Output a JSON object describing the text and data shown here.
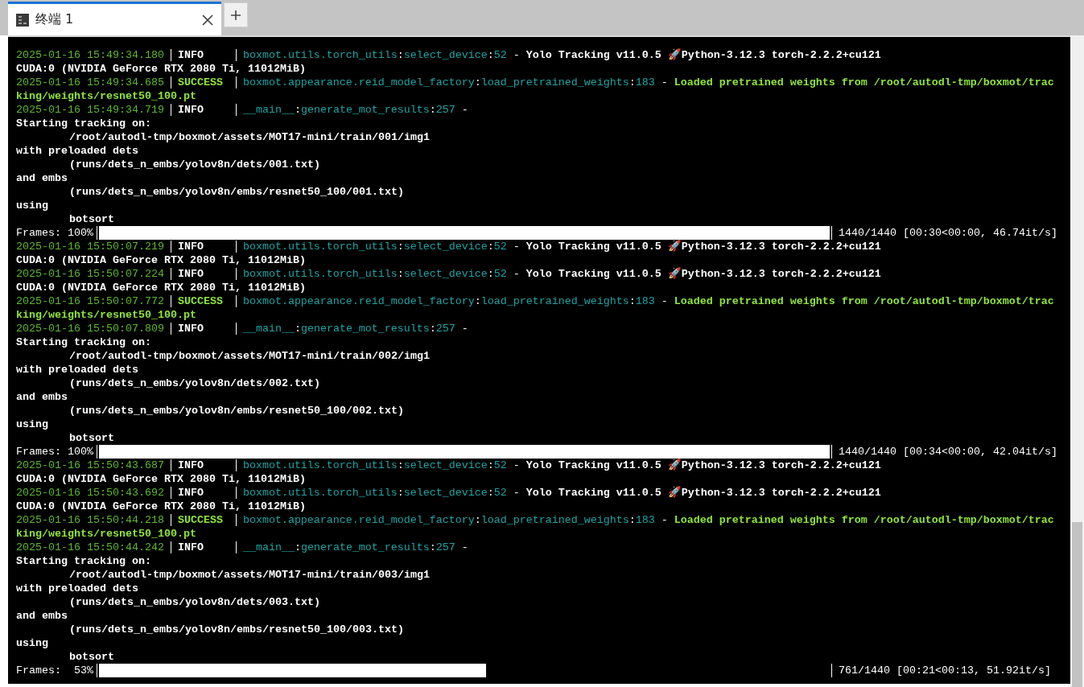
{
  "tabs": [
    {
      "title": "终端 1",
      "selected": true
    }
  ],
  "lines": [
    {
      "kind": "log",
      "time": "2025-01-16 15:49:34.180",
      "level": "INFO",
      "source": "boxmot.utils.torch_utils:select_device:52 - ",
      "message": "Yolo Tracking v11.0.5 🚀Python-3.12.3 torch-2.2.2+cu121",
      "continuation": "CUDA:0 (NVIDIA GeForce RTX 2080 Ti, 11012MiB)"
    },
    {
      "kind": "log",
      "time": "2025-01-16 15:49:34.685",
      "level": "SUCCESS",
      "source": "boxmot.appearance.reid_model_factory:load_pretrained_weights:183 - ",
      "message": "Loaded pretrained weights from /root/autodl-tmp/boxmot/trac",
      "continuation": "king/weights/resnet50_100.pt"
    },
    {
      "kind": "log",
      "time": "2025-01-16 15:49:34.719",
      "level": "INFO",
      "source": "__main__:generate_mot_results:257 - "
    },
    {
      "kind": "text",
      "text": "Starting tracking on:"
    },
    {
      "kind": "indented",
      "text": "/root/autodl-tmp/boxmot/assets/MOT17-mini/train/001/img1"
    },
    {
      "kind": "text",
      "text": "with preloaded dets"
    },
    {
      "kind": "indented",
      "text": "(runs/dets_n_embs/yolov8n/dets/001.txt)"
    },
    {
      "kind": "text",
      "text": "and embs"
    },
    {
      "kind": "indented",
      "text": "(runs/dets_n_embs/yolov8n/embs/resnet50_100/001.txt)"
    },
    {
      "kind": "text",
      "text": "using"
    },
    {
      "kind": "indented",
      "text": "botsort"
    },
    {
      "kind": "progress",
      "label": "Frames: 100%",
      "level": 1,
      "stats": "1440/1440 [00:30<00:00, 46.74it/s]"
    },
    {
      "kind": "log",
      "time": "2025-01-16 15:50:07.219",
      "level": "INFO",
      "source": "boxmot.utils.torch_utils:select_device:52 - ",
      "message": "Yolo Tracking v11.0.5 🚀Python-3.12.3 torch-2.2.2+cu121",
      "continuation": "CUDA:0 (NVIDIA GeForce RTX 2080 Ti, 11012MiB)"
    },
    {
      "kind": "log",
      "time": "2025-01-16 15:50:07.224",
      "level": "INFO",
      "source": "boxmot.utils.torch_utils:select_device:52 - ",
      "message": "Yolo Tracking v11.0.5 🚀Python-3.12.3 torch-2.2.2+cu121",
      "continuation": "CUDA:0 (NVIDIA GeForce RTX 2080 Ti, 11012MiB)"
    },
    {
      "kind": "log",
      "time": "2025-01-16 15:50:07.772",
      "level": "SUCCESS",
      "source": "boxmot.appearance.reid_model_factory:load_pretrained_weights:183 - ",
      "message": "Loaded pretrained weights from /root/autodl-tmp/boxmot/trac",
      "continuation": "king/weights/resnet50_100.pt"
    },
    {
      "kind": "log",
      "time": "2025-01-16 15:50:07.809",
      "level": "INFO",
      "source": "__main__:generate_mot_results:257 - "
    },
    {
      "kind": "text",
      "text": "Starting tracking on:"
    },
    {
      "kind": "indented",
      "text": "/root/autodl-tmp/boxmot/assets/MOT17-mini/train/002/img1"
    },
    {
      "kind": "text",
      "text": "with preloaded dets"
    },
    {
      "kind": "indented",
      "text": "(runs/dets_n_embs/yolov8n/dets/002.txt)"
    },
    {
      "kind": "text",
      "text": "and embs"
    },
    {
      "kind": "indented",
      "text": "(runs/dets_n_embs/yolov8n/embs/resnet50_100/002.txt)"
    },
    {
      "kind": "text",
      "text": "using"
    },
    {
      "kind": "indented",
      "text": "botsort"
    },
    {
      "kind": "progress",
      "label": "Frames: 100%",
      "level": 1,
      "stats": "1440/1440 [00:34<00:00, 42.04it/s]"
    },
    {
      "kind": "log",
      "time": "2025-01-16 15:50:43.687",
      "level": "INFO",
      "source": "boxmot.utils.torch_utils:select_device:52 - ",
      "message": "Yolo Tracking v11.0.5 🚀Python-3.12.3 torch-2.2.2+cu121",
      "continuation": "CUDA:0 (NVIDIA GeForce RTX 2080 Ti, 11012MiB)"
    },
    {
      "kind": "log",
      "time": "2025-01-16 15:50:43.692",
      "level": "INFO",
      "source": "boxmot.utils.torch_utils:select_device:52 - ",
      "message": "Yolo Tracking v11.0.5 🚀Python-3.12.3 torch-2.2.2+cu121",
      "continuation": "CUDA:0 (NVIDIA GeForce RTX 2080 Ti, 11012MiB)"
    },
    {
      "kind": "log",
      "time": "2025-01-16 15:50:44.218",
      "level": "SUCCESS",
      "source": "boxmot.appearance.reid_model_factory:load_pretrained_weights:183 - ",
      "message": "Loaded pretrained weights from /root/autodl-tmp/boxmot/trac",
      "continuation": "king/weights/resnet50_100.pt"
    },
    {
      "kind": "log",
      "time": "2025-01-16 15:50:44.242",
      "level": "INFO",
      "source": "__main__:generate_mot_results:257 - "
    },
    {
      "kind": "text",
      "text": "Starting tracking on:"
    },
    {
      "kind": "indented",
      "text": "/root/autodl-tmp/boxmot/assets/MOT17-mini/train/003/img1"
    },
    {
      "kind": "text",
      "text": "with preloaded dets"
    },
    {
      "kind": "indented",
      "text": "(runs/dets_n_embs/yolov8n/dets/003.txt)"
    },
    {
      "kind": "text",
      "text": "and embs"
    },
    {
      "kind": "indented",
      "text": "(runs/dets_n_embs/yolov8n/embs/resnet50_100/003.txt)"
    },
    {
      "kind": "text",
      "text": "using"
    },
    {
      "kind": "indented",
      "text": "botsort"
    },
    {
      "kind": "progress",
      "label": "Frames:  53%",
      "level": 0.53,
      "stats": "761/1440 [00:21<00:13, 51.92it/s]"
    }
  ]
}
